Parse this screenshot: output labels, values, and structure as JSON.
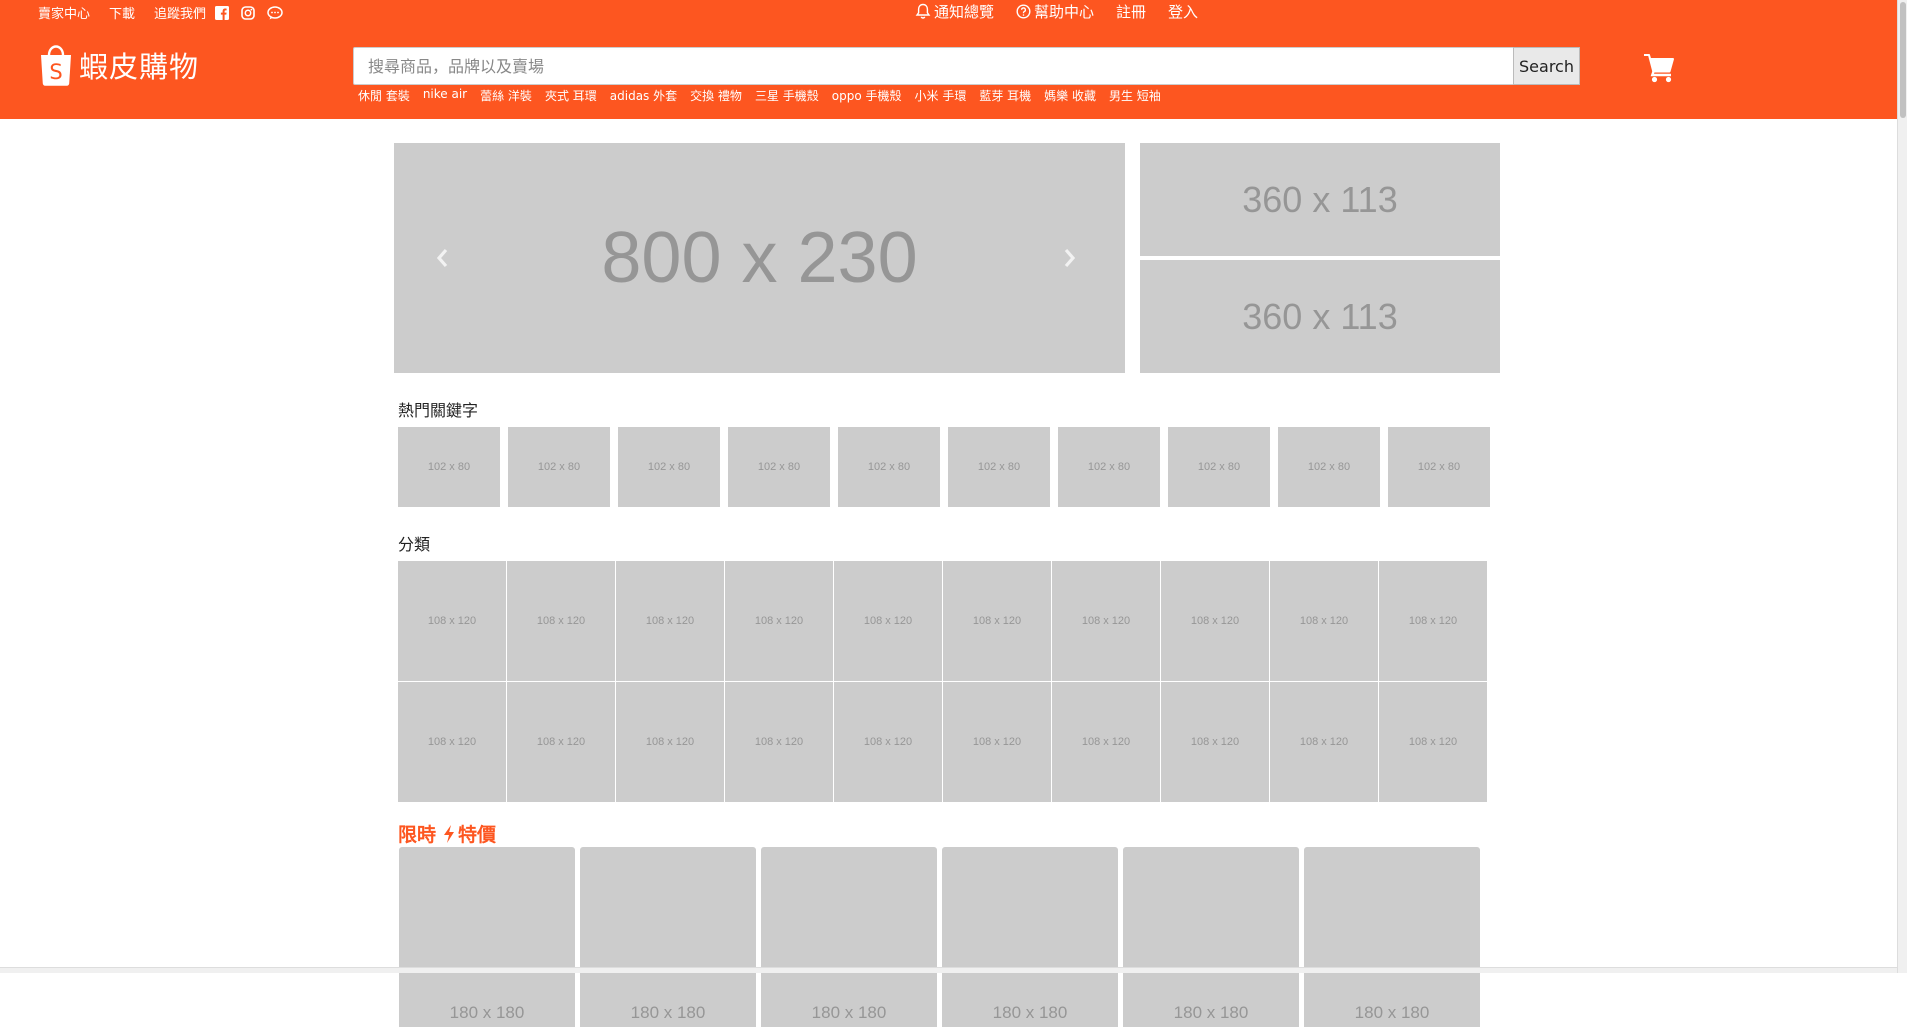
{
  "topbar": {
    "seller_center": "賣家中心",
    "download": "下載",
    "follow_us": "追蹤我們",
    "notifications": "通知總覽",
    "help_center": "幫助中心",
    "register": "註冊",
    "login": "登入"
  },
  "brand": {
    "name": "蝦皮購物",
    "accent": "#fd5620"
  },
  "search": {
    "placeholder": "搜尋商品，品牌以及賣場",
    "value": "",
    "button": "Search"
  },
  "hotwords": [
    "休閒 套裝",
    "nike air",
    "蕾絲 洋裝",
    "夾式 耳環",
    "adidas 外套",
    "交換 禮物",
    "三星 手機殼",
    "oppo 手機殼",
    "小米 手環",
    "藍芽 耳機",
    "媽樂 收藏",
    "男生 短袖"
  ],
  "banners": {
    "main": "800 x 230",
    "side": [
      "360 x 113",
      "360 x 113"
    ],
    "prev_icon": "chevron-left-icon",
    "next_icon": "chevron-right-icon"
  },
  "keywords": {
    "title": "熱門關鍵字",
    "items": [
      "102 x 80",
      "102 x 80",
      "102 x 80",
      "102 x 80",
      "102 x 80",
      "102 x 80",
      "102 x 80",
      "102 x 80",
      "102 x 80",
      "102 x 80"
    ]
  },
  "categories": {
    "title": "分類",
    "rows": [
      [
        "108 x 120",
        "108 x 120",
        "108 x 120",
        "108 x 120",
        "108 x 120",
        "108 x 120",
        "108 x 120",
        "108 x 120",
        "108 x 120",
        "108 x 120"
      ],
      [
        "108 x 120",
        "108 x 120",
        "108 x 120",
        "108 x 120",
        "108 x 120",
        "108 x 120",
        "108 x 120",
        "108 x 120",
        "108 x 120",
        "108 x 120"
      ]
    ]
  },
  "flash_sale": {
    "title_a": "限時",
    "title_b": "特價",
    "items": [
      "180 x 180",
      "180 x 180",
      "180 x 180",
      "180 x 180",
      "180 x 180",
      "180 x 180"
    ]
  }
}
